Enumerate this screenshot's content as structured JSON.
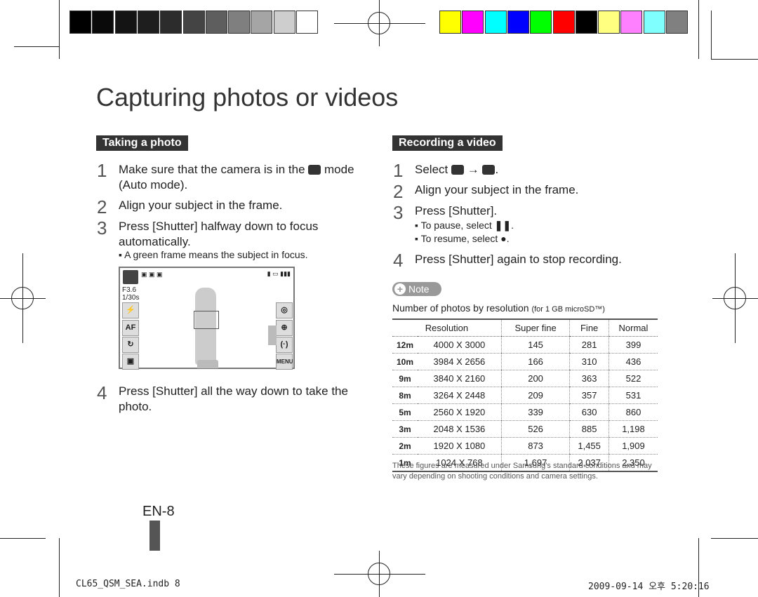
{
  "colors": {
    "gray_swatches": [
      "#000000",
      "#0a0a0a",
      "#141414",
      "#1e1e1e",
      "#2c2c2c",
      "#444444",
      "#5e5e5e",
      "#7f7f7f",
      "#a5a5a5",
      "#cecece",
      "#ffffff"
    ],
    "color_swatches": [
      "#ffff00",
      "#ff00ff",
      "#00ffff",
      "#0000ff",
      "#00ff00",
      "#ff0000",
      "#000000",
      "#ffff80",
      "#ff80ff",
      "#80ffff",
      "#808080"
    ]
  },
  "title": "Capturing photos or videos",
  "left": {
    "header": "Taking a photo",
    "steps": [
      {
        "n": "1",
        "text1": "Make sure that the camera is in the",
        "icon": "camera-icon",
        "text2": "mode",
        "text3": "(Auto mode)."
      },
      {
        "n": "2",
        "text": "Align your subject in the frame."
      },
      {
        "n": "3",
        "text": "Press [Shutter] halfway down to focus",
        "text2": "automatically."
      },
      {
        "n": "4",
        "text": "Press [Shutter] all the way down to take the",
        "text2": "photo."
      }
    ],
    "bullet": "A green frame means the subject in focus.",
    "screen": {
      "aperture": "F3.6",
      "shutter": "1/30s",
      "af": "AF",
      "menu": "MENU"
    }
  },
  "right": {
    "header": "Recording a video",
    "steps": [
      {
        "n": "1",
        "text": "Select"
      },
      {
        "n": "2",
        "text": "Align your subject in the frame."
      },
      {
        "n": "3",
        "text": "Press [Shutter]."
      },
      {
        "n": "4",
        "text": "Press [Shutter] again to stop recording."
      }
    ],
    "bullets": [
      "To pause, select",
      "To resume, select"
    ],
    "note_label": "Note",
    "table_title": "Number of photos by resolution",
    "table_sub": "(for 1 GB microSD™)",
    "columns": [
      "Resolution",
      "Super fine",
      "Fine",
      "Normal"
    ],
    "rows": [
      [
        "12m",
        "4000 X 3000",
        "145",
        "281",
        "399"
      ],
      [
        "10m",
        "3984 X 2656",
        "166",
        "310",
        "436"
      ],
      [
        "9m",
        "3840 X 2160",
        "200",
        "363",
        "522"
      ],
      [
        "8m",
        "3264 X 2448",
        "209",
        "357",
        "531"
      ],
      [
        "5m",
        "2560 X 1920",
        "339",
        "630",
        "860"
      ],
      [
        "3m",
        "2048 X 1536",
        "526",
        "885",
        "1,198"
      ],
      [
        "2m",
        "1920 X 1080",
        "873",
        "1,455",
        "1,909"
      ],
      [
        "1m",
        "1024 X 768",
        "1,697",
        "2,037",
        "2,350"
      ]
    ],
    "footnote": "These figures are measured under Samsung's standard conditions and may vary depending on shooting conditions and camera settings."
  },
  "page_number": "EN-8",
  "footer": {
    "file": "CL65_QSM_SEA.indb   8",
    "date": "2009-09-14   오후 5:20:16"
  }
}
